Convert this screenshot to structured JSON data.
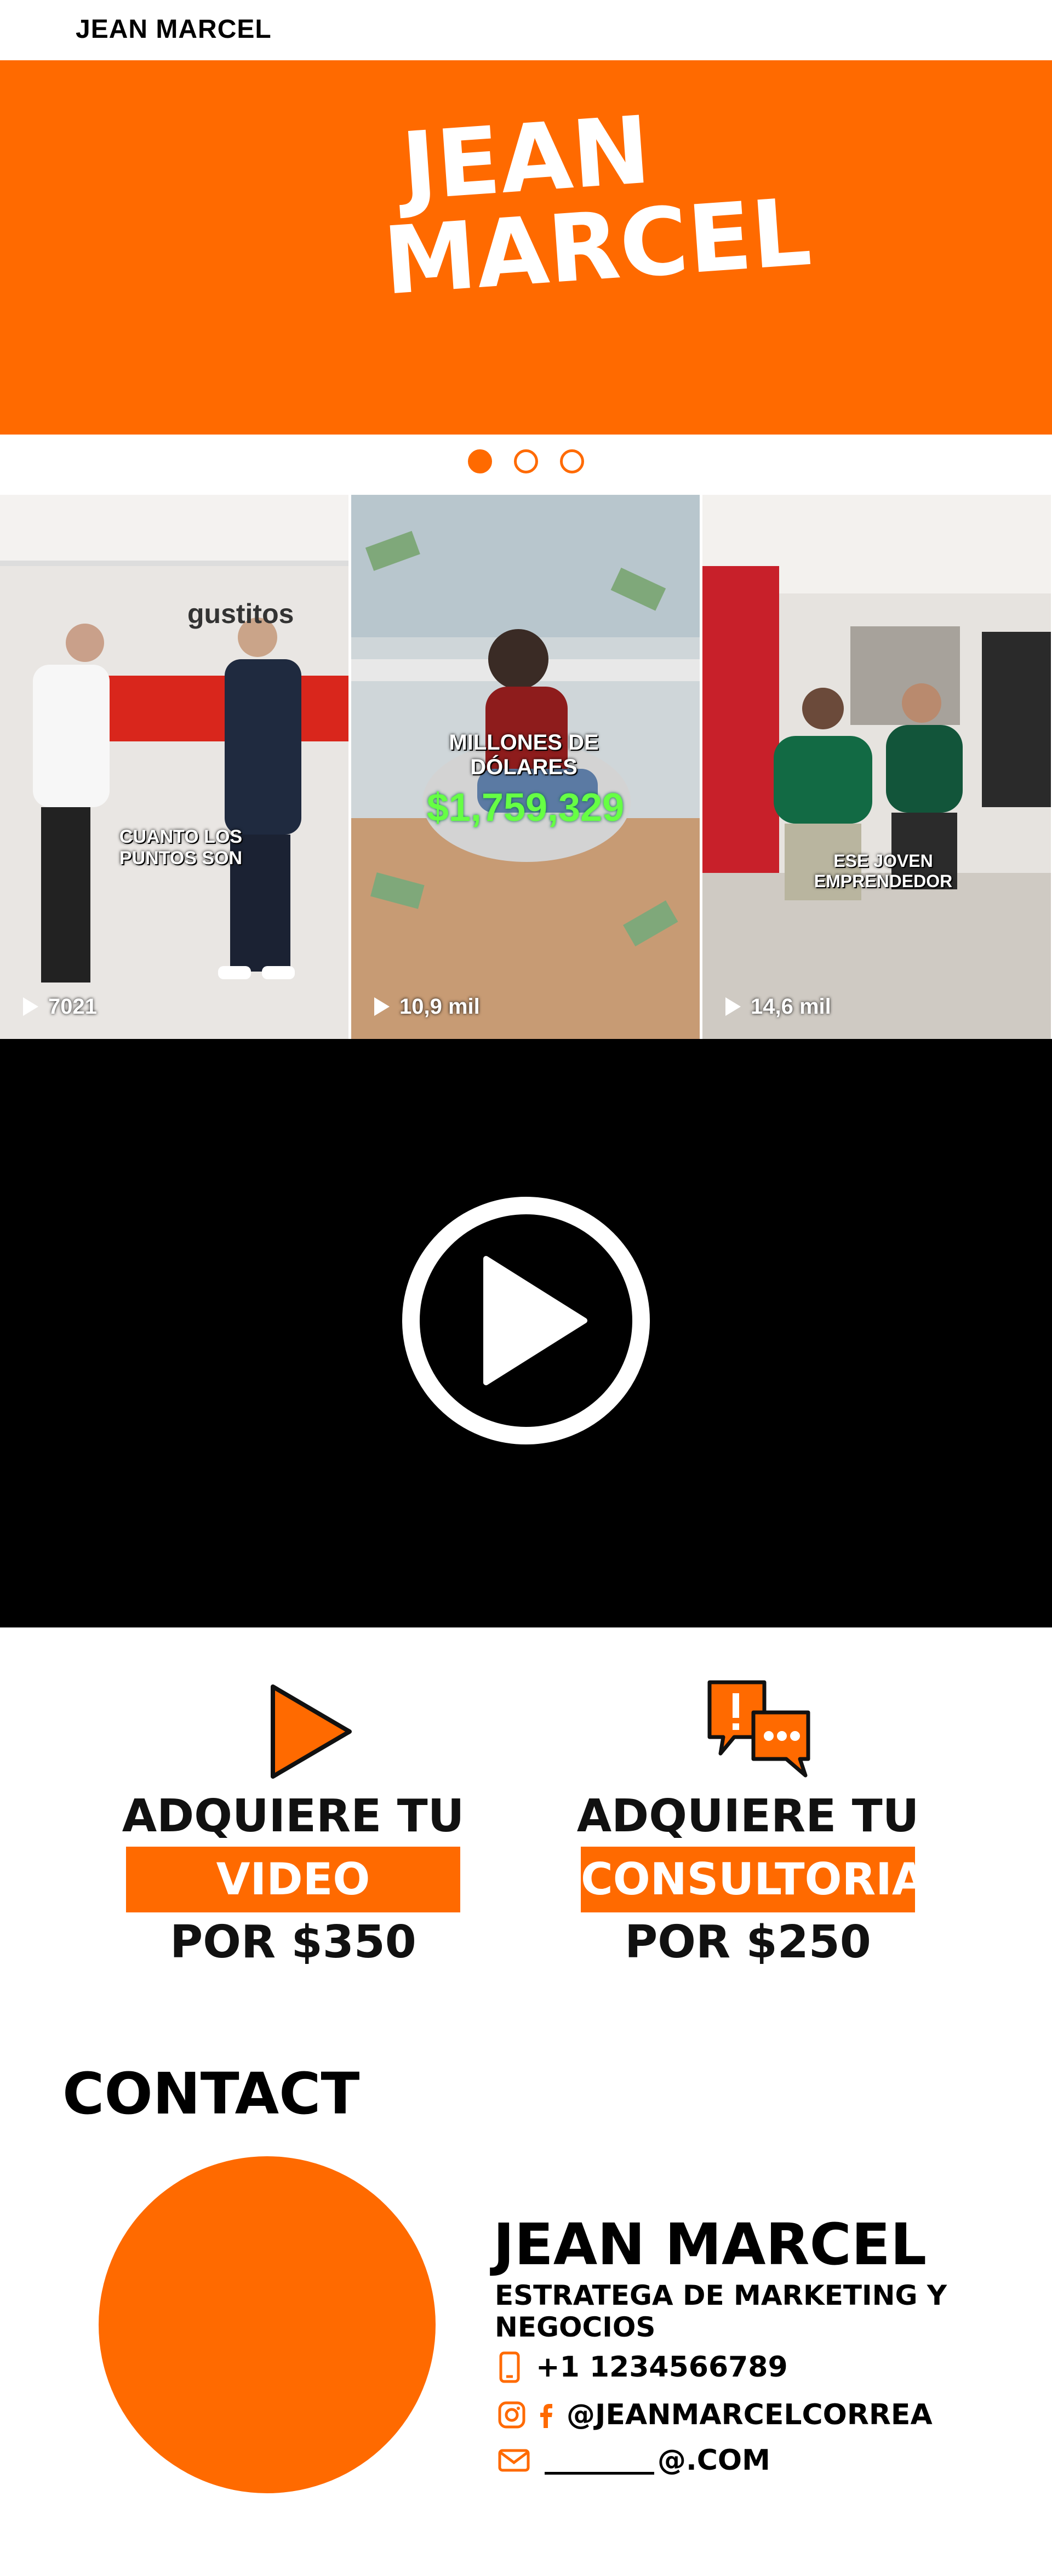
{
  "header": {
    "site_name": "JEAN MARCEL"
  },
  "hero": {
    "logo_line1": "JEAN",
    "logo_line2": "MARCEL"
  },
  "carousel": {
    "dots": 3,
    "active": 0
  },
  "gallery": [
    {
      "caption": "CUANTO LOS PUNTOS SON",
      "views": "7021",
      "sign_text": "gustitos"
    },
    {
      "caption": "MILLONES DE DÓLARES",
      "money": "$1,759,329",
      "views": "10,9 mil"
    },
    {
      "caption": "ESE JOVEN EMPRENDEDOR",
      "views": "14,6 mil"
    }
  ],
  "offers": [
    {
      "icon": "play-triangle-icon",
      "line1": "ADQUIERE TU",
      "highlight": "VIDEO",
      "price": "POR $350"
    },
    {
      "icon": "chat-bubbles-icon",
      "line1": "ADQUIERE TU",
      "highlight": "CONSULTORIA",
      "price": "POR $250"
    }
  ],
  "contact": {
    "title": "CONTACT",
    "name": "JEAN MARCEL",
    "role": "ESTRATEGA DE MARKETING Y NEGOCIOS",
    "phone": "+1 1234566789",
    "social": "@JEANMARCELCORREA",
    "email_suffix": "@.COM"
  },
  "colors": {
    "accent": "#ff6a00",
    "video_bg": "#000000"
  }
}
